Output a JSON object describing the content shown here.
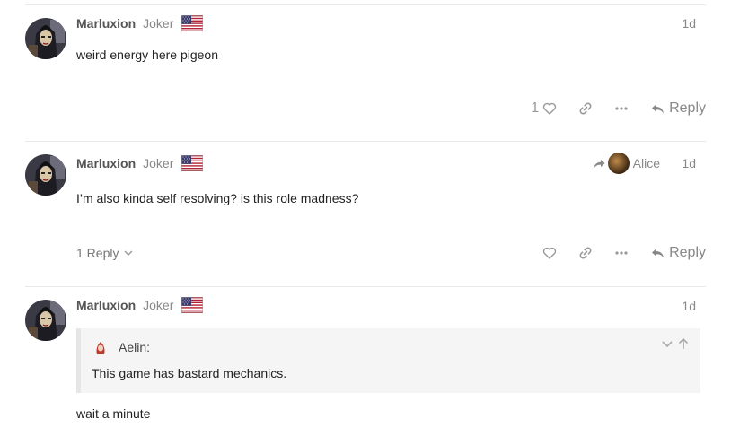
{
  "posts": [
    {
      "username": "Marluxion",
      "user_title": "Joker",
      "date": "1d",
      "text": "weird energy here pigeon",
      "likes": "1",
      "reply_label": "Reply"
    },
    {
      "username": "Marluxion",
      "user_title": "Joker",
      "date": "1d",
      "reply_to_user": "Alice",
      "text": "I’m also kinda self resolving? is this role madness?",
      "replies_label": "1 Reply",
      "reply_label": "Reply"
    },
    {
      "username": "Marluxion",
      "user_title": "Joker",
      "date": "1d",
      "quote": {
        "author": "Aelin:",
        "text": "This game has bastard mechanics."
      },
      "text": "wait a minute"
    }
  ],
  "colors": {
    "text_muted": "#888888",
    "icon": "#999999",
    "quote_bg": "#f5f5f5",
    "flag_red": "#b22234",
    "flag_blue": "#3c3b6e"
  },
  "icons": {
    "heart": "heart-icon",
    "link": "link-icon",
    "more": "ellipsis-icon",
    "reply": "reply-arrow-icon",
    "flag": "us-flag-icon"
  }
}
